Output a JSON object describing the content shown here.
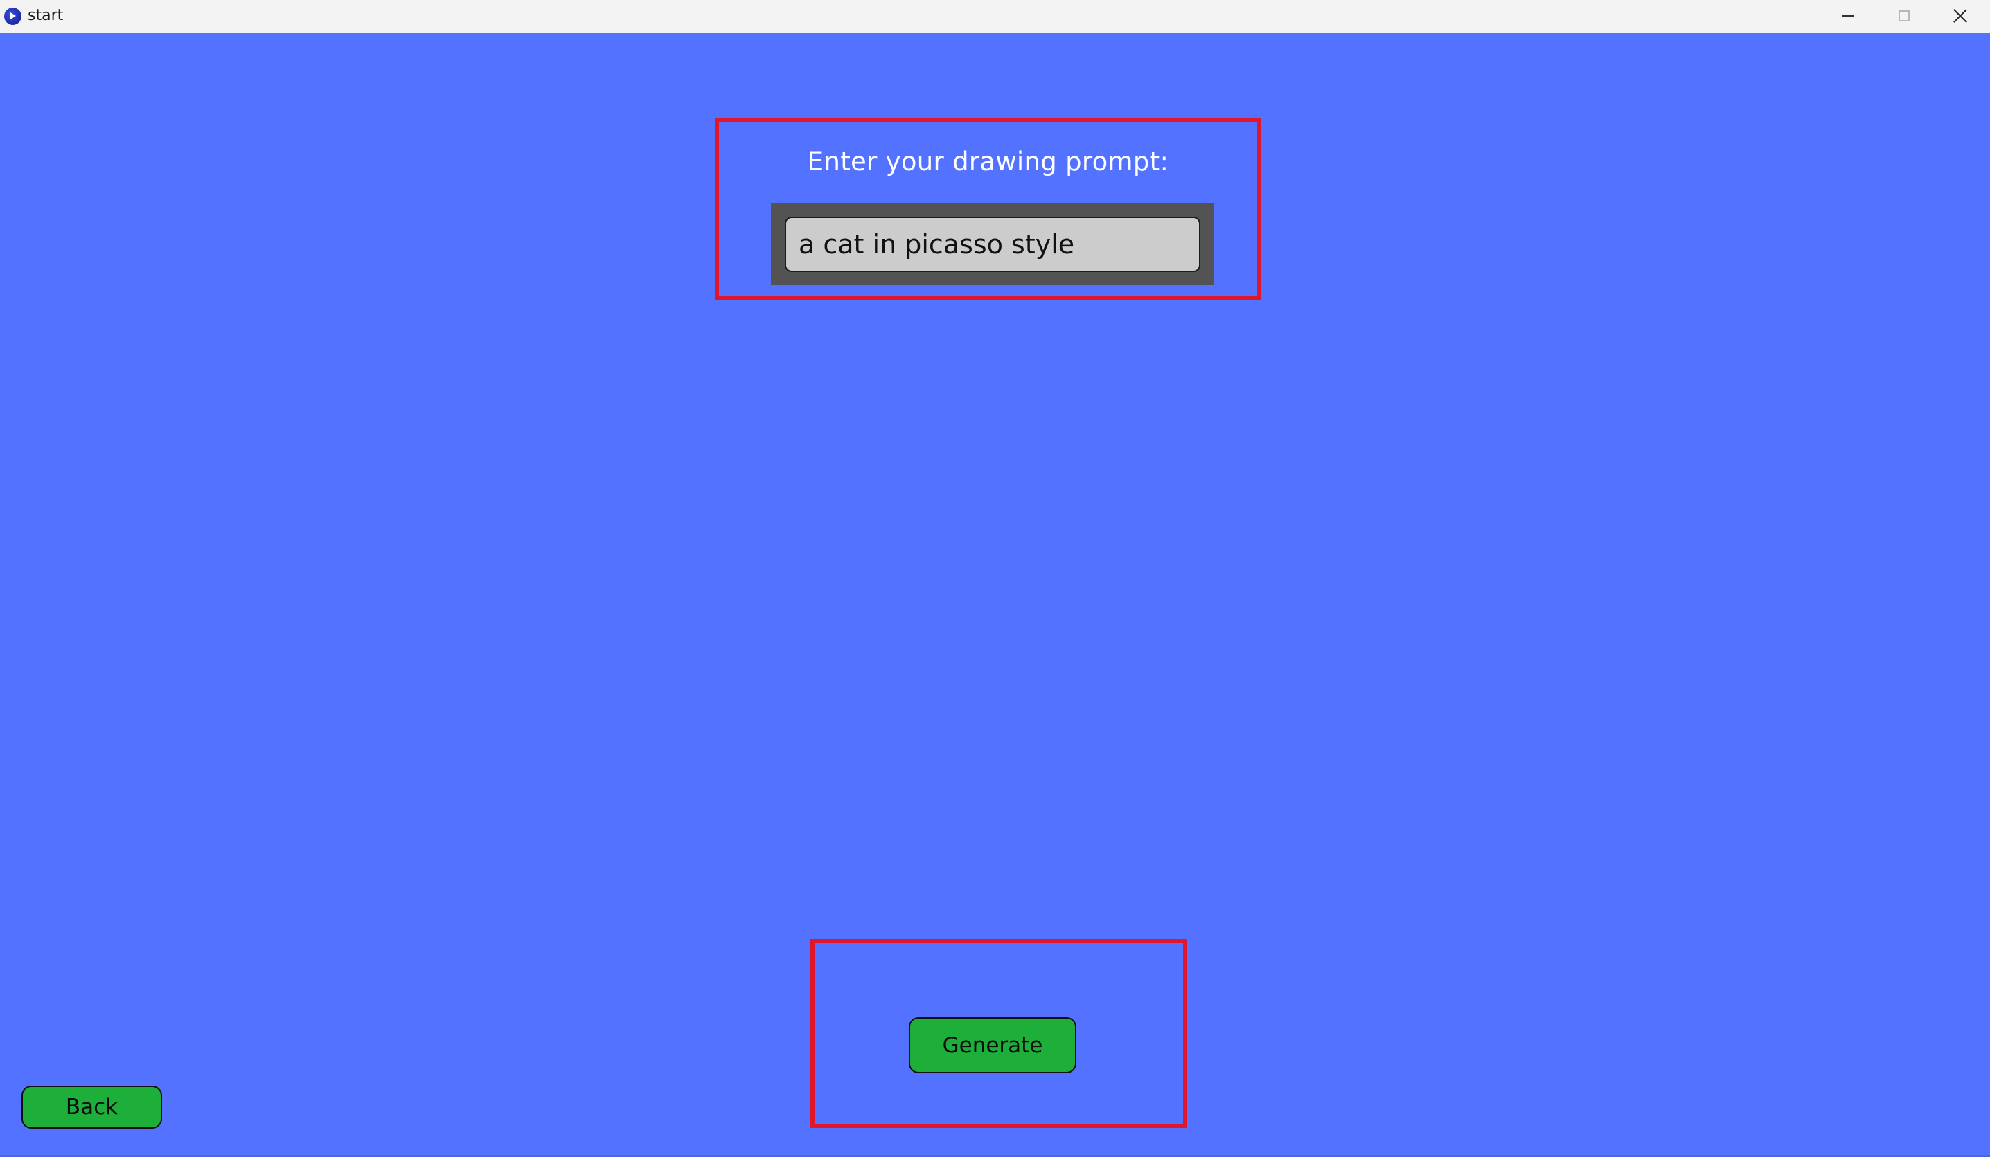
{
  "window": {
    "title": "start",
    "app_icon": "processing-app-icon",
    "controls": [
      "minimize-icon",
      "maximize-icon",
      "close-icon"
    ]
  },
  "colors": {
    "background": "#5372ff",
    "highlight_border": "#e0162b",
    "input_frame": "#535353",
    "input_fill": "#cccccc",
    "button_green": "#1eaf3a"
  },
  "prompt": {
    "label": "Enter your drawing prompt:",
    "value": "a cat in picasso style"
  },
  "buttons": {
    "generate_label": "Generate",
    "back_label": "Back"
  }
}
